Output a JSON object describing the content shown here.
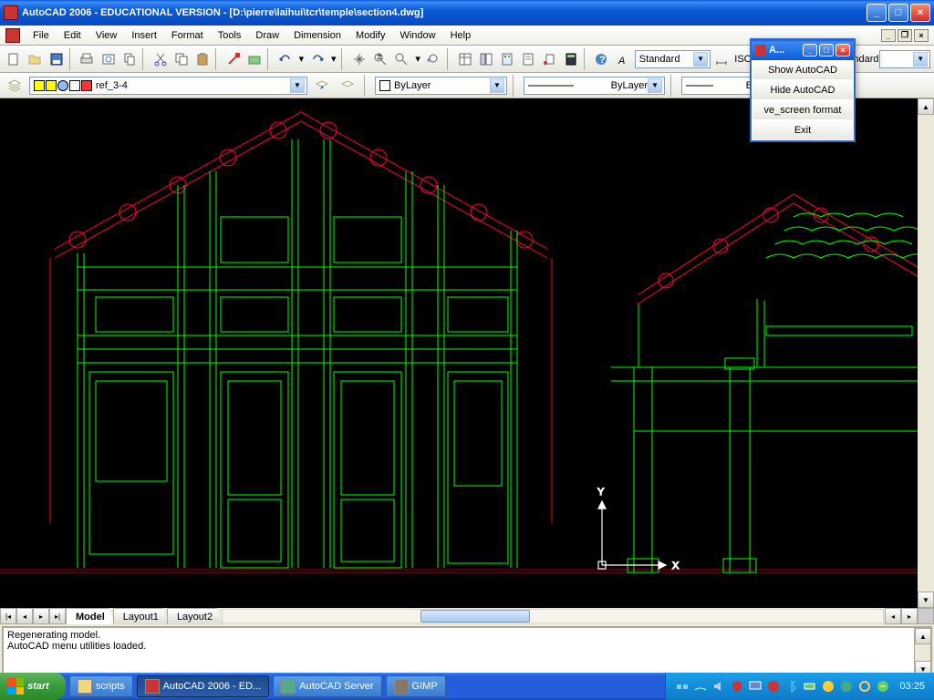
{
  "title": "AutoCAD 2006 - EDUCATIONAL VERSION - [D:\\pierre\\laihui\\tcr\\temple\\section4.dwg]",
  "menu": [
    "File",
    "Edit",
    "View",
    "Insert",
    "Format",
    "Tools",
    "Draw",
    "Dimension",
    "Modify",
    "Window",
    "Help"
  ],
  "textstyle": "Standard",
  "dimstyle_a": "ISO",
  "dimstyle_b": "andard",
  "layer": "ref_3-4",
  "color_val": "ByLayer",
  "ltype_val": "ByLayer",
  "lweight_val": "ByLayer",
  "tabs": [
    "Model",
    "Layout1",
    "Layout2"
  ],
  "cmd": {
    "l1": "Regenerating model.",
    "l2": "AutoCAD menu utilities loaded."
  },
  "popup": {
    "title": "A...",
    "items": [
      "Show AutoCAD",
      "Hide AutoCAD",
      "ve_screen format",
      "Exit"
    ]
  },
  "taskbar": {
    "start": "start",
    "items": [
      "scripts",
      "AutoCAD 2006 - ED...",
      "AutoCAD Server",
      "GIMP"
    ],
    "time": "03:25"
  },
  "ucs": {
    "x": "X",
    "y": "Y"
  },
  "colors": {
    "green": "#00ff00",
    "red": "#ff0033",
    "darkred": "#aa0000",
    "white": "#ffffff"
  }
}
